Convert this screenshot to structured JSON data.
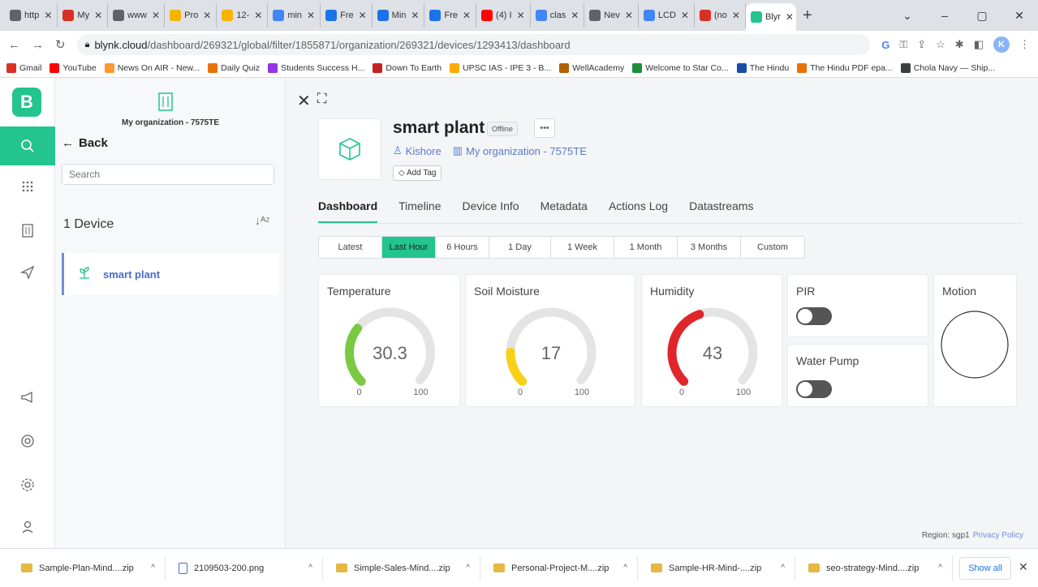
{
  "browser": {
    "tabs": [
      {
        "label": "http",
        "color": "#5f6368",
        "icon": "globe-icon"
      },
      {
        "label": "My",
        "color": "#d93025",
        "icon": "ruby-icon"
      },
      {
        "label": "www",
        "color": "#5f6368",
        "icon": "globe-icon"
      },
      {
        "label": "Pro",
        "color": "#f4b400",
        "icon": "windows-icon"
      },
      {
        "label": "12-",
        "color": "#f4b400",
        "icon": "windows-icon"
      },
      {
        "label": "min",
        "color": "#4285f4",
        "icon": "google-icon"
      },
      {
        "label": "Fre",
        "color": "#1a73e8",
        "icon": "t-icon"
      },
      {
        "label": "Min",
        "color": "#1a73e8",
        "icon": "t-icon"
      },
      {
        "label": "Fre",
        "color": "#1a73e8",
        "icon": "t-icon"
      },
      {
        "label": "(4) I",
        "color": "#ff0000",
        "icon": "youtube-icon"
      },
      {
        "label": "clas",
        "color": "#4285f4",
        "icon": "google-icon"
      },
      {
        "label": "Nev",
        "color": "#5f6368",
        "icon": "chrome-icon"
      },
      {
        "label": "LCD",
        "color": "#4285f4",
        "icon": "google-icon"
      },
      {
        "label": "(no",
        "color": "#d93025",
        "icon": "gmail-icon"
      },
      {
        "label": "Blyr",
        "color": "#23c48e",
        "icon": "blynk-icon",
        "active": true
      }
    ],
    "url_host": "blynk.cloud",
    "url_path": "/dashboard/269321/global/filter/1855871/organization/269321/devices/1293413/dashboard",
    "profile_initial": "K",
    "bookmarks": [
      {
        "label": "Gmail",
        "color": "#d93025"
      },
      {
        "label": "YouTube",
        "color": "#ff0000"
      },
      {
        "label": "News On AIR - New...",
        "color": "#ff9933"
      },
      {
        "label": "Daily Quiz",
        "color": "#e8710a"
      },
      {
        "label": "Students Success H...",
        "color": "#9334e6"
      },
      {
        "label": "Down To Earth",
        "color": "#c5221f"
      },
      {
        "label": "UPSC IAS - IPE 3 - B...",
        "color": "#f9ab00"
      },
      {
        "label": "WellAcademy",
        "color": "#b06000"
      },
      {
        "label": "Welcome to Star Co...",
        "color": "#1e8e3e"
      },
      {
        "label": "The Hindu",
        "color": "#174ea6"
      },
      {
        "label": "The Hindu PDF epa...",
        "color": "#e8710a"
      },
      {
        "label": "Chola Navy — Ship...",
        "color": "#3c4043"
      }
    ]
  },
  "sidebar": {
    "org_name": "My organization - 7575TE",
    "back_label": "Back",
    "search_placeholder": "Search",
    "device_count": "1 Device",
    "device_name": "smart plant"
  },
  "device": {
    "title": "smart plant",
    "status": "Offline",
    "owner": "Kishore",
    "org": "My organization - 7575TE",
    "add_tag": "Add Tag"
  },
  "tabs": [
    "Dashboard",
    "Timeline",
    "Device Info",
    "Metadata",
    "Actions Log",
    "Datastreams"
  ],
  "active_tab": 0,
  "ranges": [
    "Latest",
    "Last Hour",
    "6 Hours",
    "1 Day",
    "1 Week",
    "1 Month",
    "3 Months",
    "Custom"
  ],
  "active_range": 1,
  "widgets": {
    "temperature": {
      "title": "Temperature",
      "value": "30.3",
      "min": "0",
      "max": "100",
      "fraction": 0.303,
      "color": "#7ac943"
    },
    "soil": {
      "title": "Soil Moisture",
      "value": "17",
      "min": "0",
      "max": "100",
      "fraction": 0.17,
      "color": "#f7d117"
    },
    "humidity": {
      "title": "Humidity",
      "value": "43",
      "min": "0",
      "max": "100",
      "fraction": 0.43,
      "color": "#e0262b"
    },
    "pir": {
      "title": "PIR",
      "on": false
    },
    "pump": {
      "title": "Water Pump",
      "on": false
    },
    "motion": {
      "title": "Motion"
    }
  },
  "footer": {
    "region": "Region: sgp1",
    "privacy": "Privacy Policy"
  },
  "downloads": [
    {
      "name": "Sample-Plan-Mind....zip",
      "type": "zip"
    },
    {
      "name": "2109503-200.png",
      "type": "png"
    },
    {
      "name": "Simple-Sales-Mind....zip",
      "type": "zip"
    },
    {
      "name": "Personal-Project-M....zip",
      "type": "zip"
    },
    {
      "name": "Sample-HR-Mind-....zip",
      "type": "zip"
    },
    {
      "name": "seo-strategy-Mind....zip",
      "type": "zip"
    }
  ],
  "show_all": "Show all",
  "colors": {
    "accent": "#23c48e",
    "link": "#5a79c9"
  }
}
